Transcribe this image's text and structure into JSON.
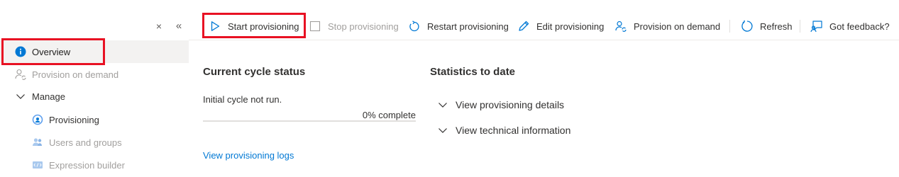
{
  "sidebar": {
    "close_glyph": "×",
    "collapse_glyph": "«",
    "items": [
      {
        "label": "Overview",
        "icon": "info-icon",
        "state": "selected"
      },
      {
        "label": "Provision on demand",
        "icon": "provision-user-icon",
        "state": "disabled"
      },
      {
        "label": "Manage",
        "icon": "chevron-down-icon",
        "state": "expanded-group"
      },
      {
        "label": "Provisioning",
        "icon": "provisioning-icon",
        "state": "enabled"
      },
      {
        "label": "Users and groups",
        "icon": "users-icon",
        "state": "disabled"
      },
      {
        "label": "Expression builder",
        "icon": "expression-icon",
        "state": "disabled"
      }
    ]
  },
  "toolbar": {
    "start": "Start provisioning",
    "stop": "Stop provisioning",
    "restart": "Restart provisioning",
    "edit": "Edit provisioning",
    "provision_on_demand": "Provision on demand",
    "refresh": "Refresh",
    "feedback": "Got feedback?"
  },
  "current_cycle": {
    "title": "Current cycle status",
    "status": "Initial cycle not run.",
    "progress_label": "0% complete",
    "progress_percent": 0,
    "logs_link": "View provisioning logs"
  },
  "statistics": {
    "title": "Statistics to date",
    "details": "View provisioning details",
    "technical": "View technical information"
  },
  "colors": {
    "accent": "#0078d4",
    "highlight": "#e81123",
    "disabled_text": "#a19f9d",
    "selected_bg": "#f3f2f1"
  }
}
